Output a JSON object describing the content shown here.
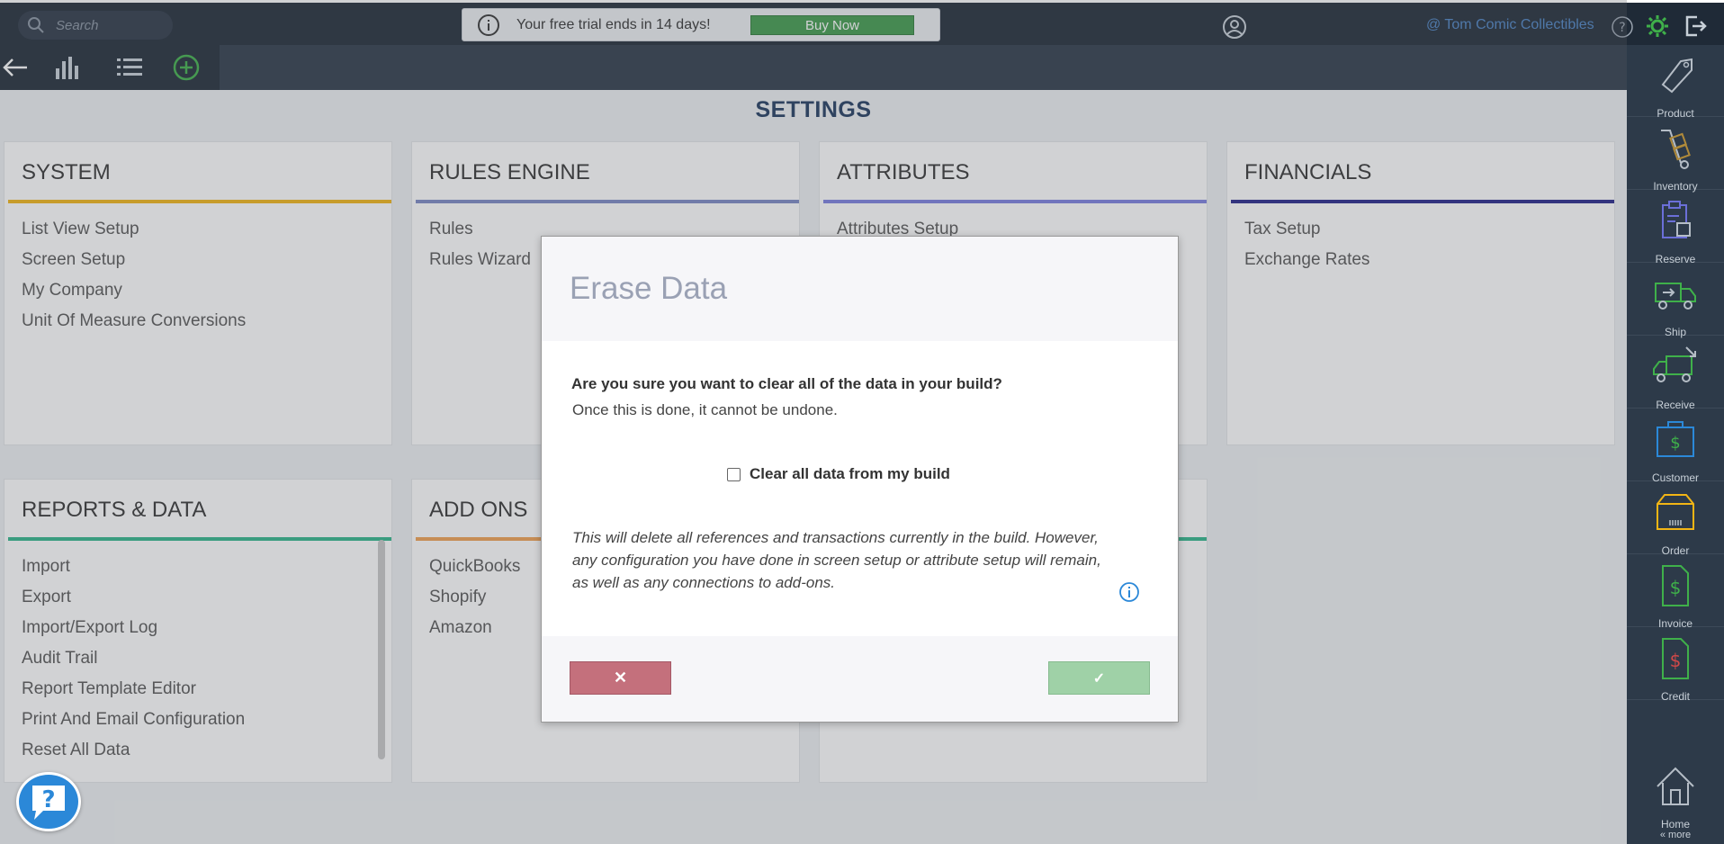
{
  "header": {
    "search_placeholder": "Search",
    "trial_text": "Your free trial ends in 14 days!",
    "buy_now_label": "Buy Now",
    "company_name": "@ Tom Comic Collectibles"
  },
  "page_title": "SETTINGS",
  "cards": {
    "system": {
      "title": "SYSTEM",
      "color": "#f2b515",
      "items": [
        "List View Setup",
        "Screen Setup",
        "My Company",
        "Unit Of Measure Conversions"
      ]
    },
    "rules": {
      "title": "RULES ENGINE",
      "color": "#7b88c4",
      "items": [
        "Rules",
        "Rules Wizard"
      ]
    },
    "attributes": {
      "title": "ATTRIBUTES",
      "color": "#7b7fe0",
      "items": [
        "Attributes Setup"
      ]
    },
    "financials": {
      "title": "FINANCIALS",
      "color": "#25258a",
      "items": [
        "Tax Setup",
        "Exchange Rates"
      ]
    },
    "reports": {
      "title": "REPORTS & DATA",
      "color": "#2fb58a",
      "items": [
        "Import",
        "Export",
        "Import/Export Log",
        "Audit Trail",
        "Report Template Editor",
        "Print And Email Configuration",
        "Reset All Data"
      ]
    },
    "addons": {
      "title": "ADD ONS",
      "color": "#f0a050",
      "items": [
        "QuickBooks",
        "Shopify",
        "Amazon"
      ]
    }
  },
  "rightbar": {
    "items": [
      "Product",
      "Inventory",
      "Reserve",
      "Ship",
      "Receive",
      "Customer",
      "Order",
      "Invoice",
      "Credit",
      "Home"
    ],
    "more_label": "« more"
  },
  "modal": {
    "title": "Erase Data",
    "question": "Are you sure you want to clear all of the data in your build?",
    "subtext": "Once this is done, it cannot be undone.",
    "checkbox_label": "Clear all data from my build",
    "checkbox_checked": false,
    "note": "This will delete all references and transactions currently in the build. However, any configuration you have done in screen setup or attribute setup will remain, as well as any connections to add-ons.",
    "cancel_symbol": "✕",
    "confirm_symbol": "✓"
  }
}
